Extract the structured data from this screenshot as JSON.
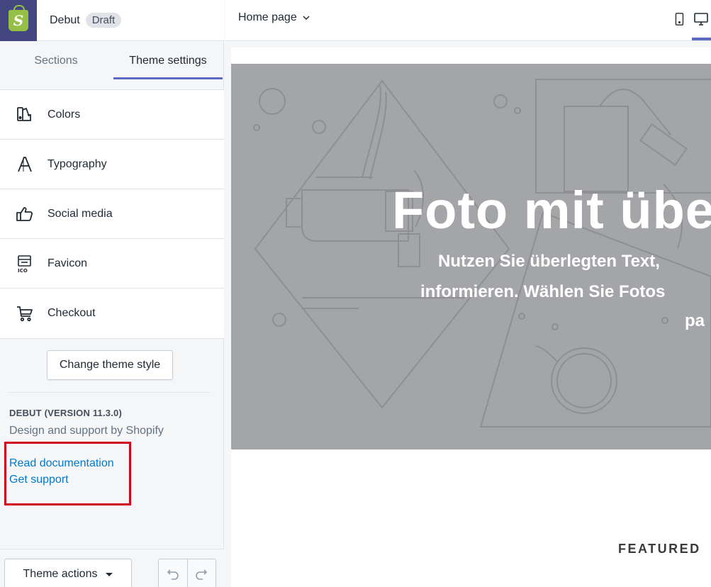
{
  "sidebar": {
    "theme_name": "Debut",
    "badge": "Draft",
    "tabs": [
      {
        "label": "Sections"
      },
      {
        "label": "Theme settings"
      }
    ],
    "items": [
      {
        "label": "Colors",
        "icon": "colors-icon"
      },
      {
        "label": "Typography",
        "icon": "typography-icon"
      },
      {
        "label": "Social media",
        "icon": "thumbs-up-icon"
      },
      {
        "label": "Favicon",
        "icon": "favicon-icon"
      },
      {
        "label": "Checkout",
        "icon": "cart-icon"
      }
    ],
    "change_style_label": "Change theme style",
    "version": "DEBUT (VERSION 11.3.0)",
    "support_by": "Design and support by Shopify",
    "links": {
      "docs": "Read documentation",
      "support": "Get support"
    },
    "theme_actions_label": "Theme actions"
  },
  "header": {
    "page_selector": "Home page"
  },
  "preview": {
    "hero_title": "Foto mit übe",
    "hero_line1": "Nutzen Sie überlegten Text,",
    "hero_line2": "informieren. Wählen Sie Fotos",
    "hero_line3": "pa",
    "featured": "FEATURED"
  },
  "colors": {
    "accent": "#5c6ac4",
    "link": "#007ace",
    "highlight": "#d0021b",
    "logo_bg": "#43467f",
    "hero_bg": "#a4a5a8"
  }
}
